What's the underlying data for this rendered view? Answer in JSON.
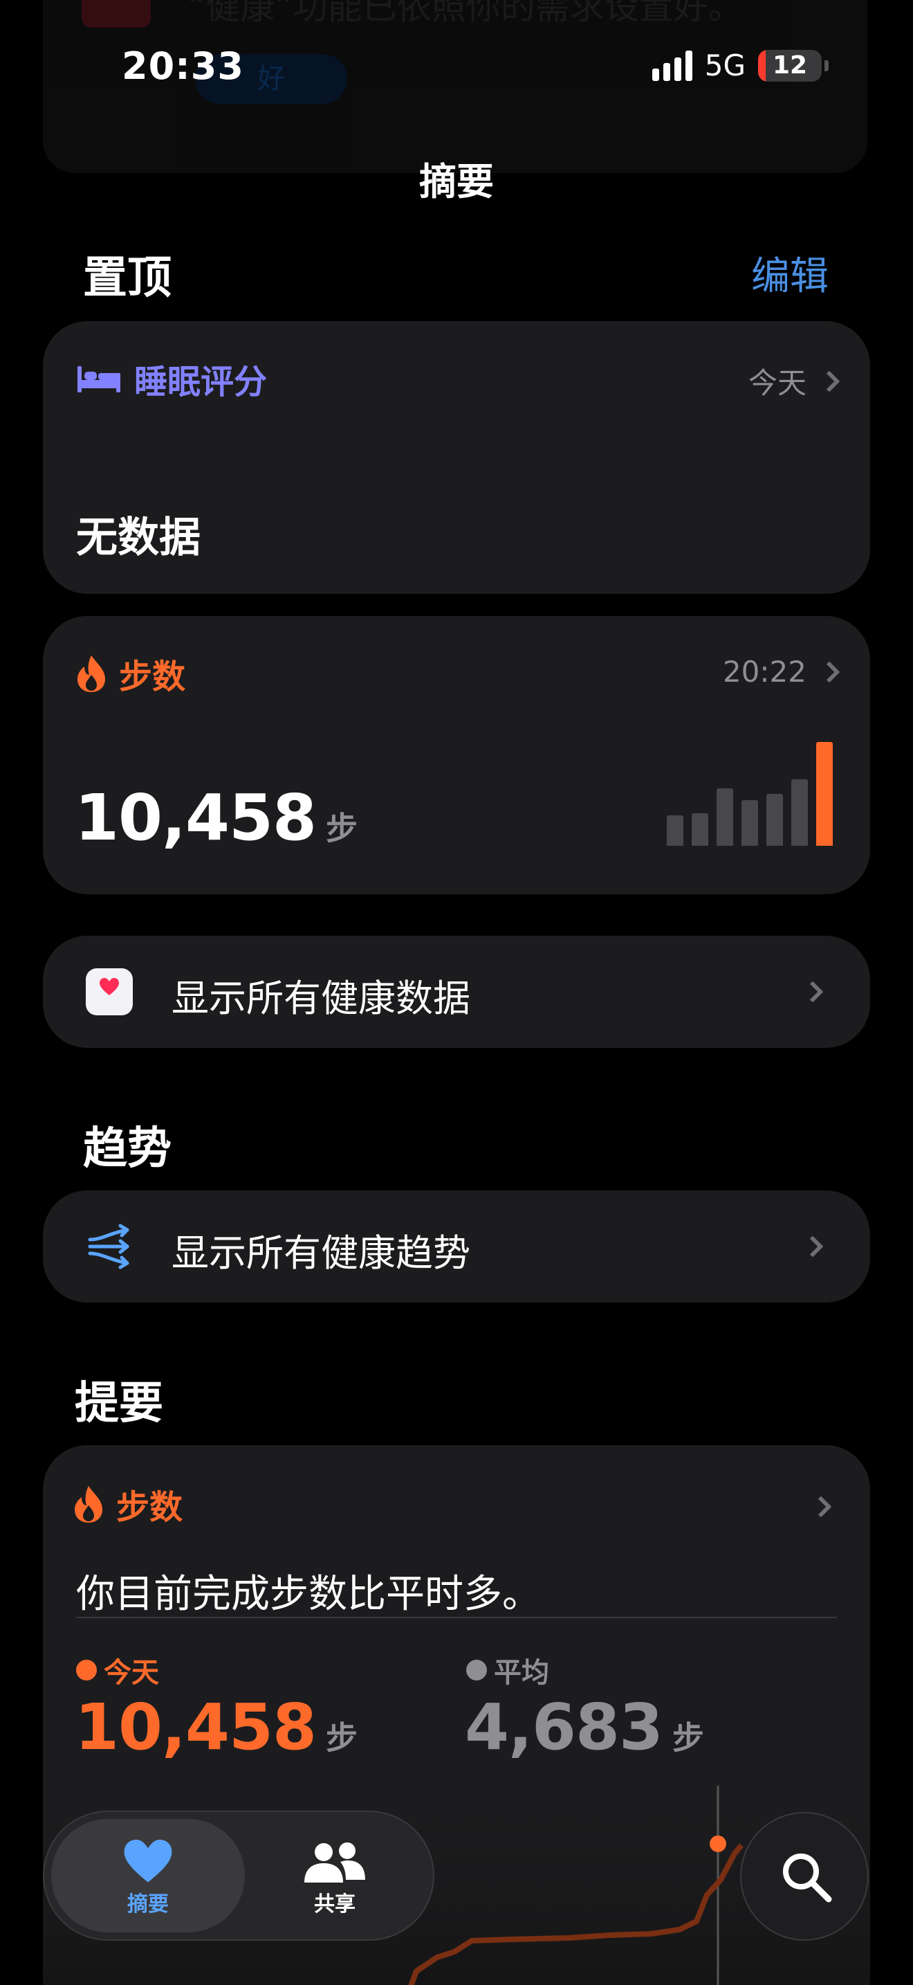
{
  "status_bar": {
    "time": "20:33",
    "network": "5G",
    "battery_level": "12"
  },
  "banner": {
    "text": "“健康”功能已依照你的需求设置好。",
    "button": "好"
  },
  "nav": {
    "title": "摘要"
  },
  "pinned": {
    "title": "置顶",
    "edit_label": "编辑"
  },
  "sleep_card": {
    "title": "睡眠评分",
    "meta": "今天",
    "value": "无数据",
    "icon": "bed-icon"
  },
  "steps_card": {
    "title": "步数",
    "time": "20:22",
    "value": "10,458",
    "unit": "步",
    "icon": "flame-icon",
    "bars": [
      0.29,
      0.31,
      0.55,
      0.44,
      0.5,
      0.64,
      1.0
    ]
  },
  "all_data": {
    "label": "显示所有健康数据",
    "icon": "health-app-icon"
  },
  "trends": {
    "title": "趋势",
    "label": "显示所有健康趋势",
    "icon": "trend-arrows-icon"
  },
  "highlights": {
    "title": "提要",
    "card_title": "步数",
    "message": "你目前完成步数比平时多。",
    "today_label": "今天",
    "today_value": "10,458",
    "avg_label": "平均",
    "avg_value": "4,683",
    "unit": "步"
  },
  "tabbar": {
    "summary_label": "摘要",
    "sharing_label": "共享"
  },
  "colors": {
    "accent": "#4a90e2",
    "steps": "#ff6a2b",
    "sleep": "#8281ff",
    "card": "#1c1c1e"
  }
}
